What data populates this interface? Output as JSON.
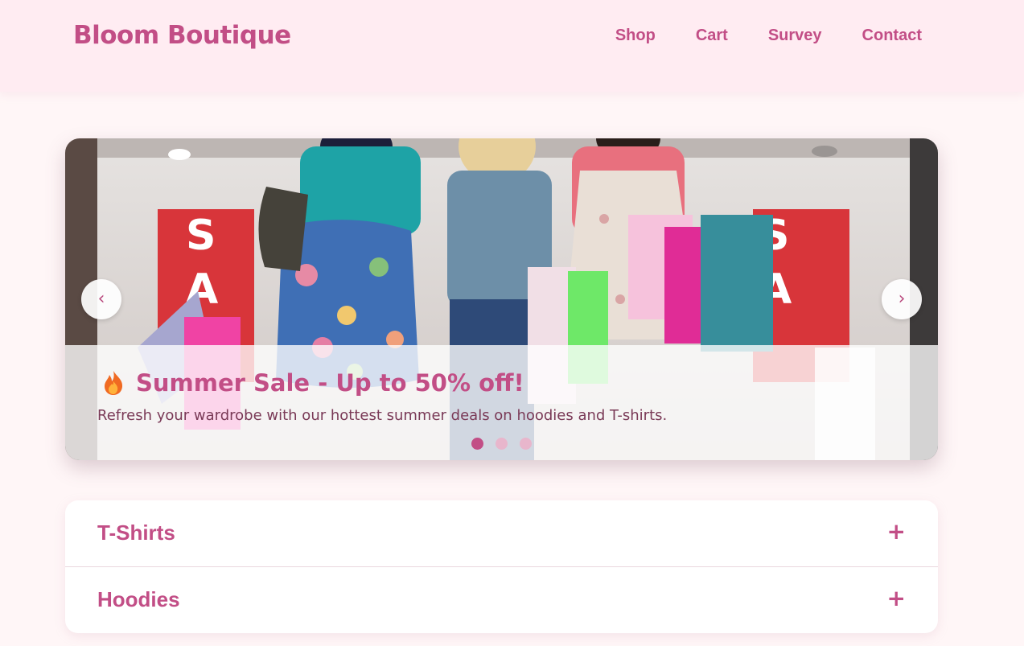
{
  "header": {
    "brand": "Bloom Boutique",
    "nav": [
      "Shop",
      "Cart",
      "Survey",
      "Contact"
    ]
  },
  "carousel": {
    "prev_label": "‹",
    "next_label": "›",
    "slide": {
      "icon": "flame-icon",
      "title": "Summer Sale - Up to 50% off!",
      "text": "Refresh your wardrobe with our hottest summer deals on hoodies and T-shirts.",
      "image": "three-women-with-shopping-bags-photo"
    },
    "dots_count": 3,
    "active_dot": 0
  },
  "accordion": {
    "items": [
      {
        "label": "T-Shirts",
        "toggle": "+"
      },
      {
        "label": "Hoodies",
        "toggle": "+"
      }
    ]
  },
  "colors": {
    "accent": "#c24e86",
    "header_bg": "#ffecf2",
    "page_bg": "#fff6f7"
  }
}
